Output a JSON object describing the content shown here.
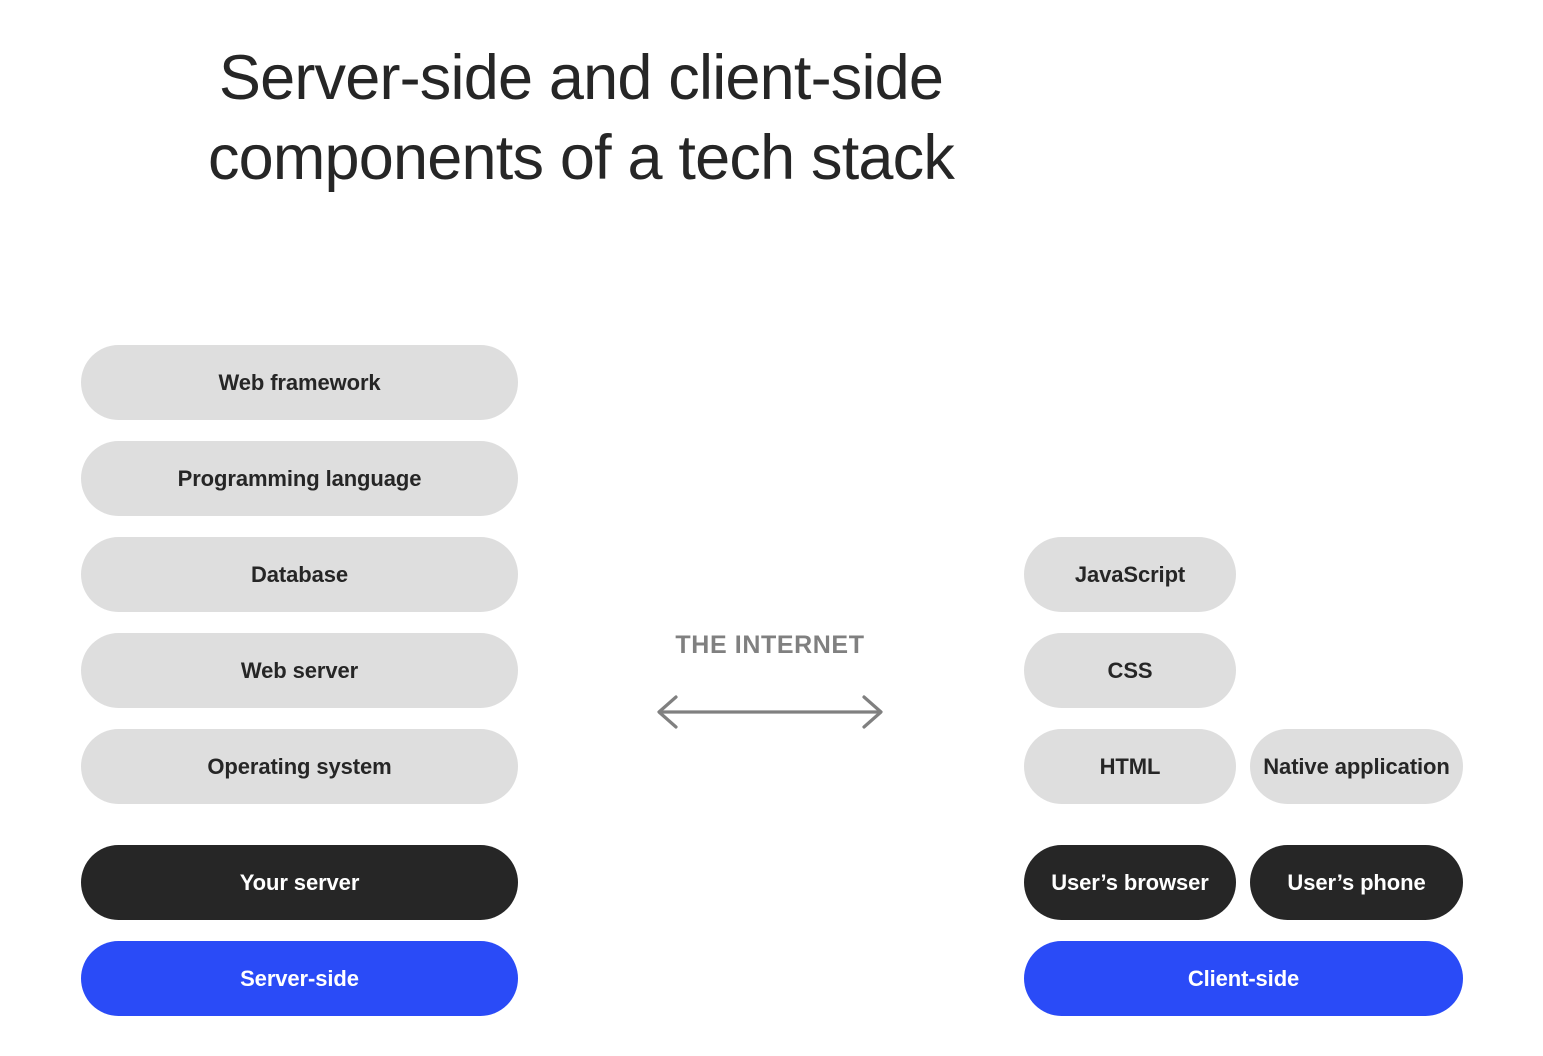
{
  "title": "Server-side and client-side\ncomponents of a tech stack",
  "colors": {
    "background": "#ffffff",
    "pill_grey": "#dedede",
    "pill_dark": "#262626",
    "pill_blue": "#2a4bf7",
    "text_dark": "#262626",
    "text_light": "#ffffff",
    "muted": "#808080"
  },
  "server_side": {
    "items": [
      {
        "label": "Web framework"
      },
      {
        "label": "Programming language"
      },
      {
        "label": "Database"
      },
      {
        "label": "Web server"
      },
      {
        "label": "Operating system"
      }
    ],
    "host_label": "Your server",
    "category_label": "Server-side"
  },
  "middle": {
    "label": "THE INTERNET",
    "arrow_icon": "double-headed-horizontal-arrow-icon"
  },
  "client_side": {
    "items": [
      {
        "label": "JavaScript"
      },
      {
        "label": "CSS"
      },
      {
        "label": "HTML"
      }
    ],
    "native_label": "Native application",
    "host_labels": [
      "User’s browser",
      "User’s phone"
    ],
    "category_label": "Client-side"
  }
}
